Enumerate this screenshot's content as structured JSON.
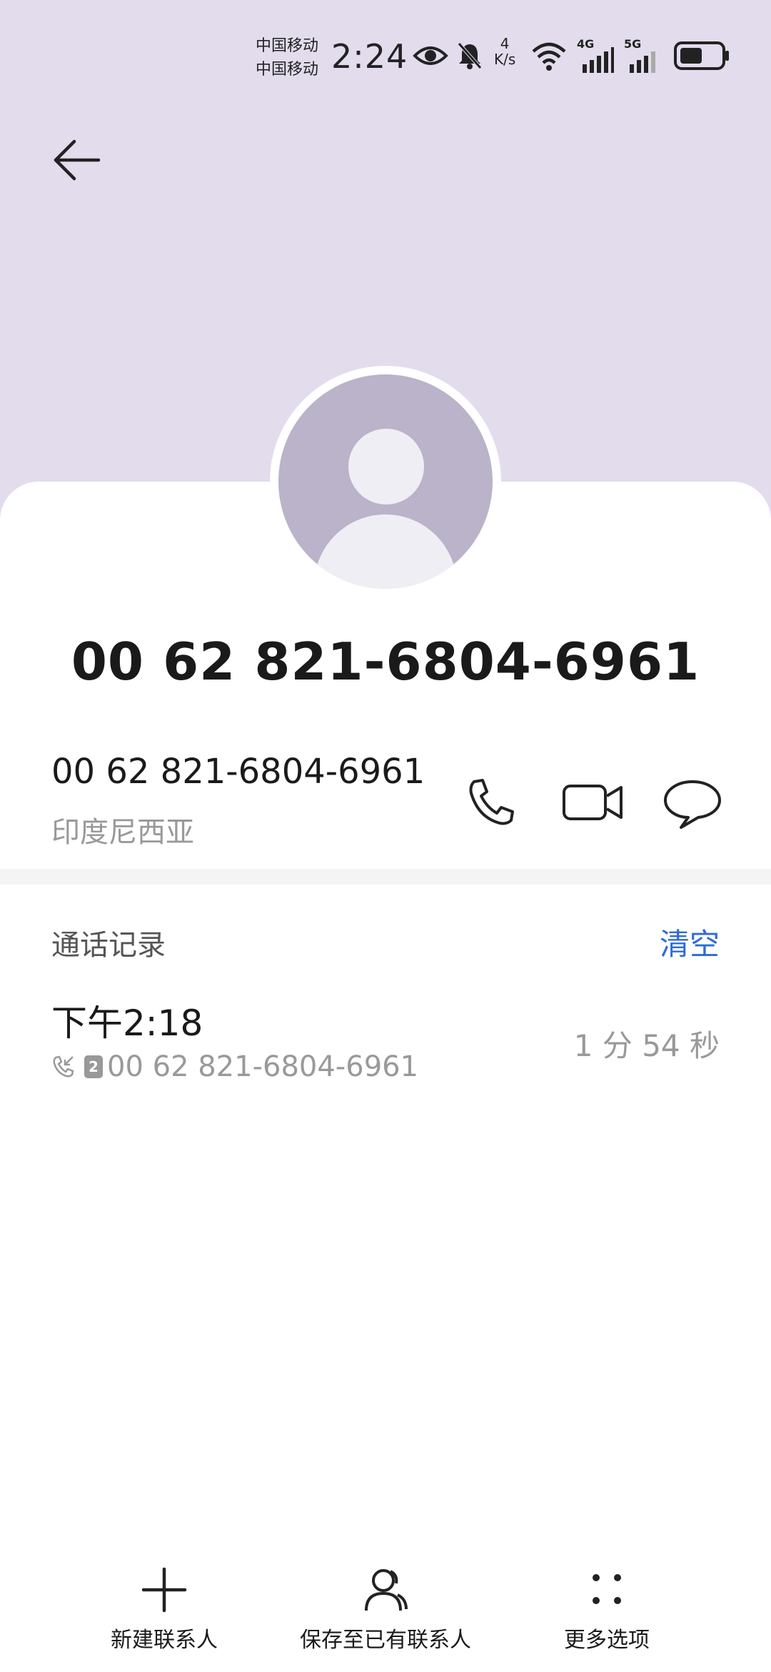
{
  "status_bar": {
    "carrier_1": "中国移动",
    "carrier_2": "中国移动",
    "time": "2:24",
    "speed_value": "4",
    "speed_unit": "K/s",
    "net_1": "4G",
    "net_2": "5G"
  },
  "contact": {
    "title_number": "00 62 821-6804-6961",
    "number": "00 62 821-6804-6961",
    "location": "印度尼西亚"
  },
  "call_log": {
    "title": "通话记录",
    "clear_label": "清空",
    "entries": [
      {
        "time": "下午2:18",
        "sim": "2",
        "number": "00 62 821-6804-6961",
        "duration": "1 分 54 秒"
      }
    ]
  },
  "bottom_bar": {
    "new_contact": "新建联系人",
    "save_existing": "保存至已有联系人",
    "more_options": "更多选项"
  },
  "colors": {
    "header_bg": "#e2dced",
    "avatar_bg": "#bab3c9",
    "accent": "#2f6bd5"
  }
}
